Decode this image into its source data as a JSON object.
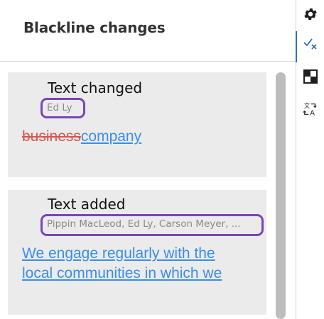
{
  "panel": {
    "title": "Blackline changes"
  },
  "toolbar": {
    "items": [
      {
        "icon": "gear-icon",
        "active": false
      },
      {
        "icon": "check-x-icon",
        "active": true
      },
      {
        "icon": "checker-icon",
        "active": false
      },
      {
        "icon": "translate-icon",
        "active": false
      }
    ]
  },
  "changes": [
    {
      "type": "Text changed",
      "authors": "Ed Ly",
      "deleted": "business",
      "inserted": "company"
    },
    {
      "type": "Text added",
      "authors": "Pippin MacLeod, Ed Ly, Carson Meyer, ...",
      "added_line_1": "We engage regularly with the",
      "added_line_2": "local communities in which we"
    }
  ],
  "colors": {
    "deleted": "#d9534f",
    "inserted": "#3a8ee6",
    "highlight_border": "#7a45b5",
    "card_bg": "#ebebeb",
    "active_tool": "#2f6fb6"
  }
}
